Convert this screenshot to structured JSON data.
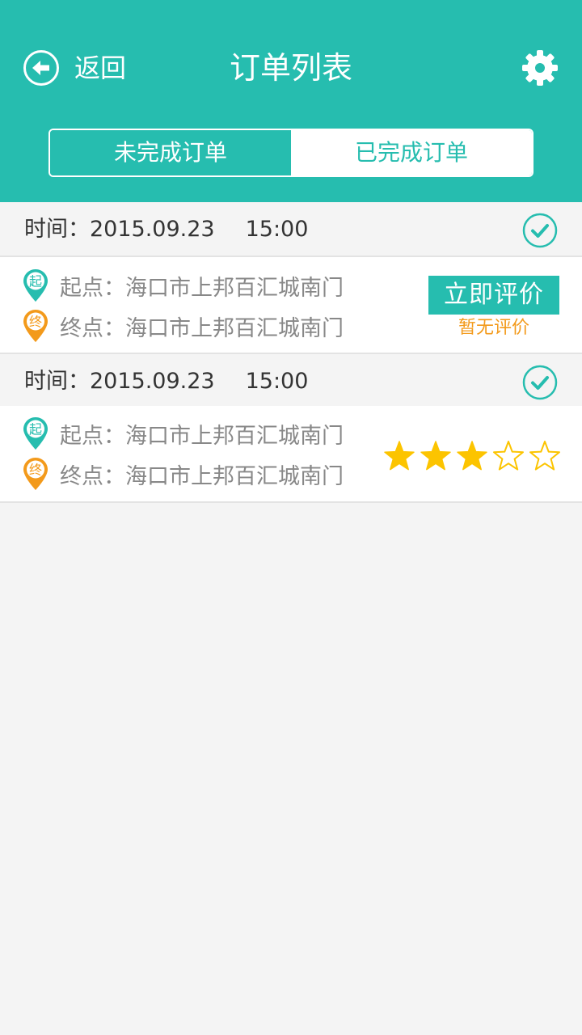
{
  "header": {
    "back_label": "返回",
    "title": "订单列表"
  },
  "tabs": [
    {
      "label": "未完成订单",
      "active": true
    },
    {
      "label": "已完成订单",
      "active": false
    }
  ],
  "orders": [
    {
      "time_prefix": "时间：",
      "date": "2015.09.23",
      "time": "15:00",
      "start_badge": "起",
      "start": "起点：海口市上邦百汇城南门",
      "end_badge": "终",
      "end": "终点：海口市上邦百汇城南门",
      "rate_button": "立即评价",
      "rating_status": "暂无评价"
    },
    {
      "time_prefix": "时间：",
      "date": "2015.09.23",
      "time": "15:00",
      "start_badge": "起",
      "start": "起点：海口市上邦百汇城南门",
      "end_badge": "终",
      "end": "终点：海口市上邦百汇城南门",
      "rating": 3,
      "rating_max": 5
    }
  ],
  "colors": {
    "accent": "#26bdaf",
    "orange": "#f39a1b",
    "star": "#fcc400"
  }
}
